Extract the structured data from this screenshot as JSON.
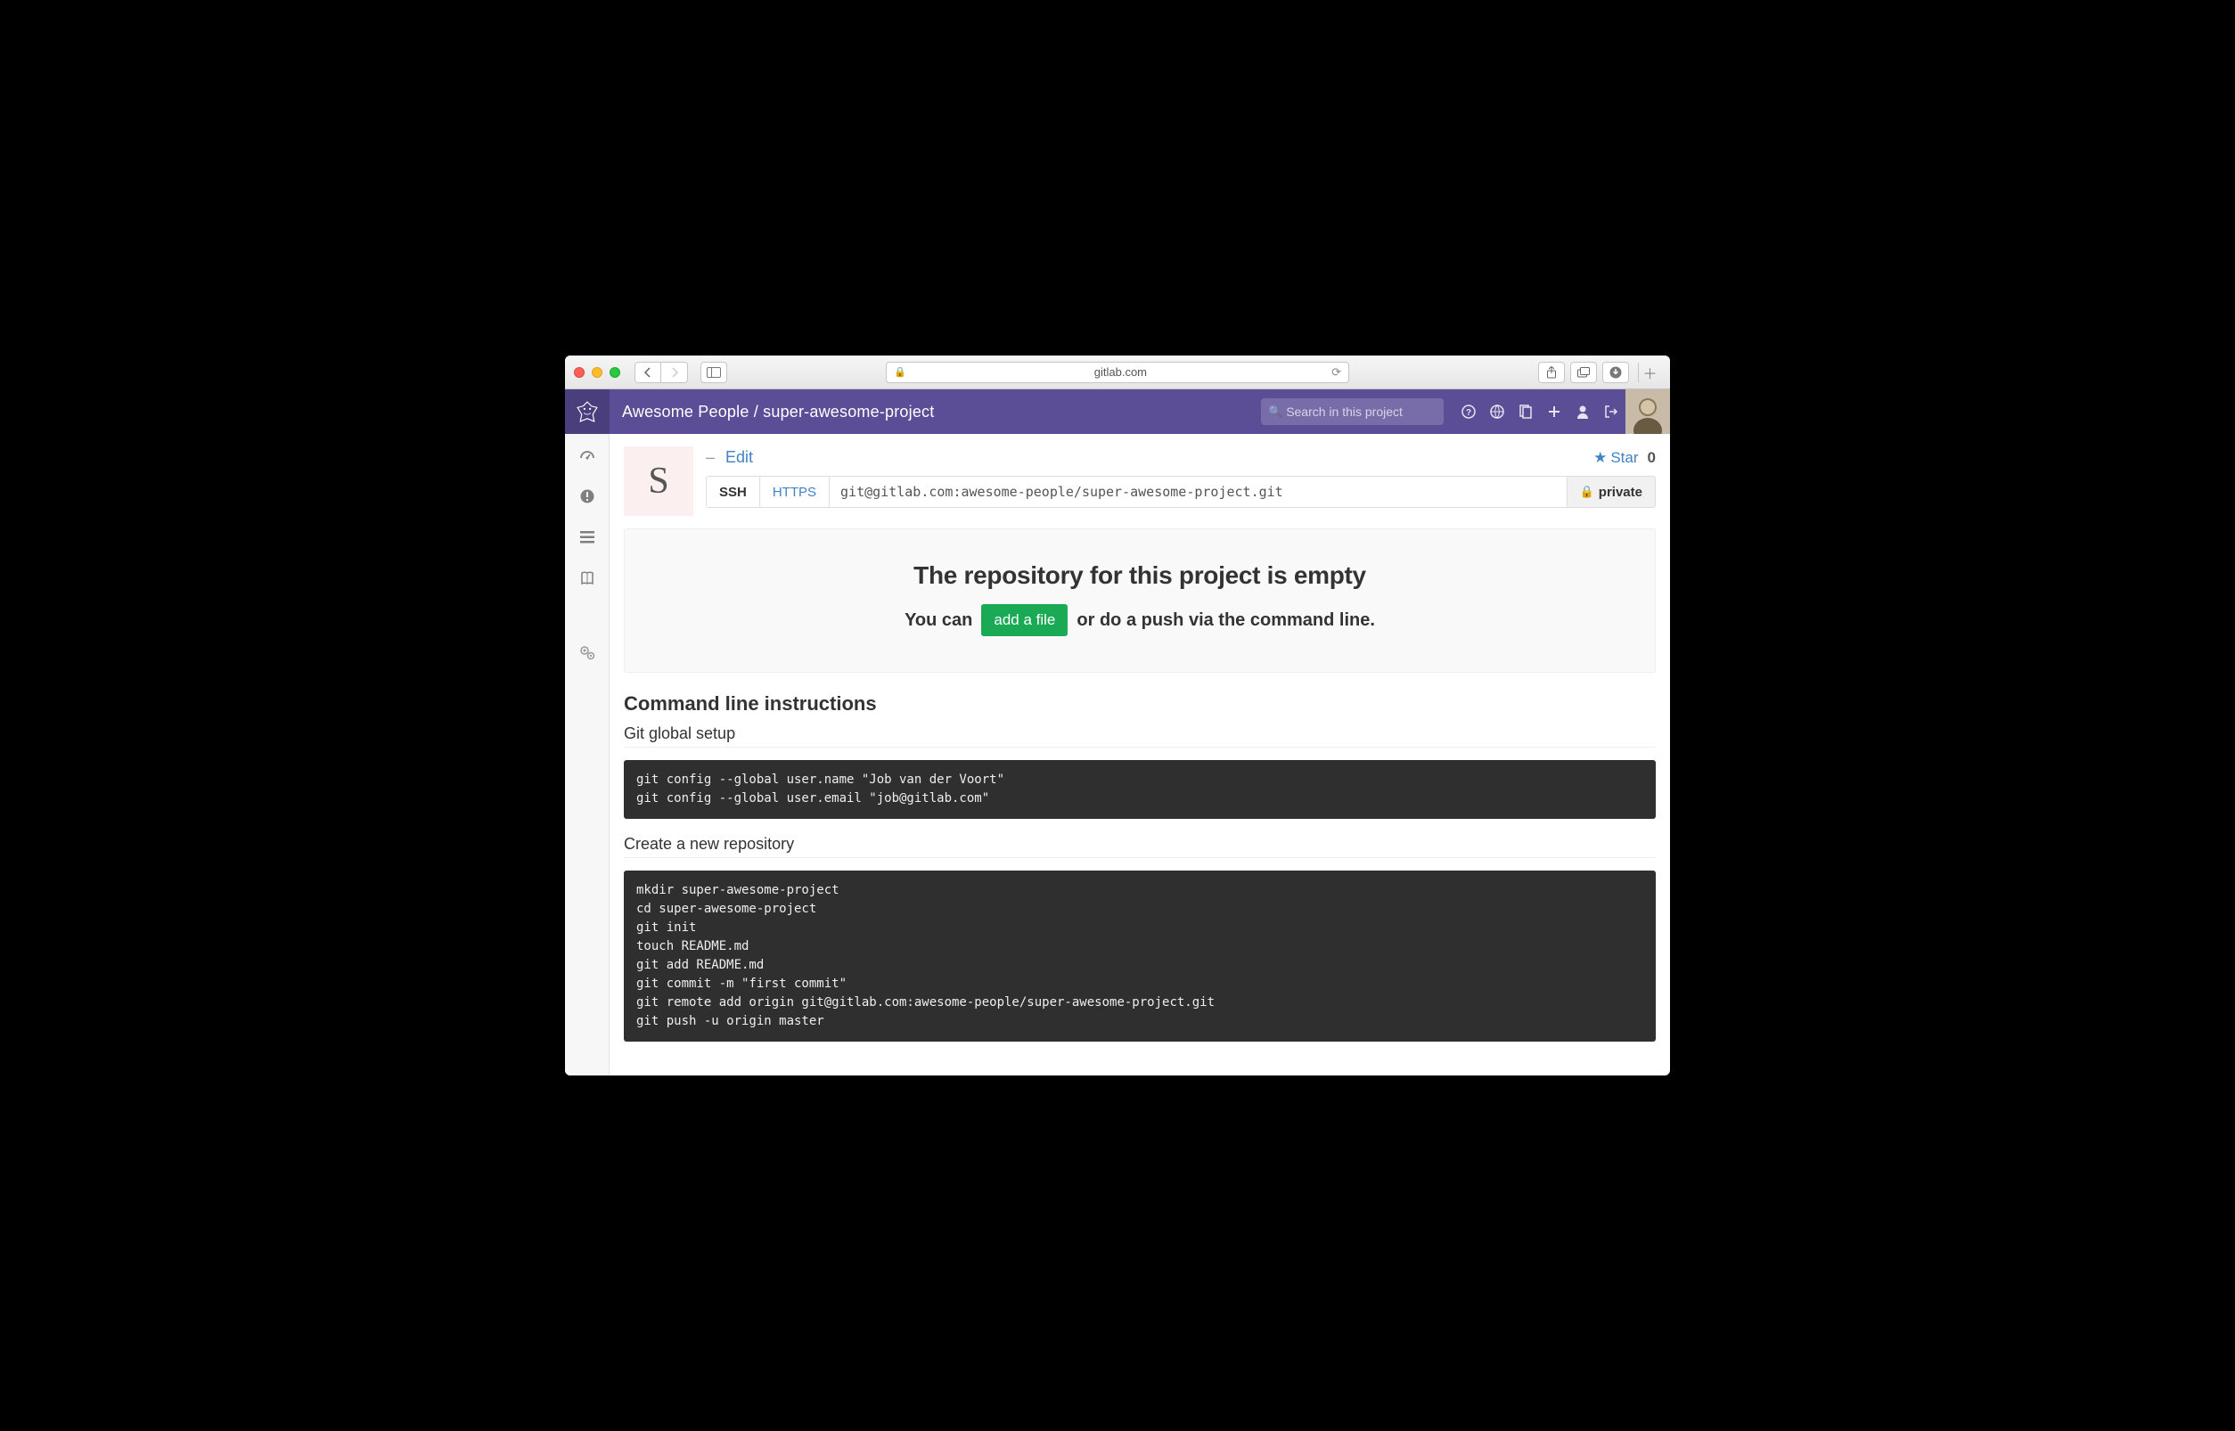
{
  "browser": {
    "domain": "gitlab.com"
  },
  "header": {
    "breadcrumb": "Awesome People / super-awesome-project",
    "search_placeholder": "Search in this project"
  },
  "project": {
    "avatar_letter": "S",
    "edit_dash": "–",
    "edit_label": "Edit",
    "star_label": "Star",
    "star_count": "0",
    "clone_tabs": {
      "ssh": "SSH",
      "https": "HTTPS"
    },
    "clone_url": "git@gitlab.com:awesome-people/super-awesome-project.git",
    "visibility": "private"
  },
  "empty": {
    "heading": "The repository for this project is empty",
    "pre": "You can",
    "button": "add a file",
    "post": "or do a push via the command line."
  },
  "instructions": {
    "title": "Command line instructions",
    "sec1_title": "Git global setup",
    "sec1_code": "git config --global user.name \"Job van der Voort\"\ngit config --global user.email \"job@gitlab.com\"",
    "sec2_title": "Create a new repository",
    "sec2_code": "mkdir super-awesome-project\ncd super-awesome-project\ngit init\ntouch README.md\ngit add README.md\ngit commit -m \"first commit\"\ngit remote add origin git@gitlab.com:awesome-people/super-awesome-project.git\ngit push -u origin master"
  }
}
